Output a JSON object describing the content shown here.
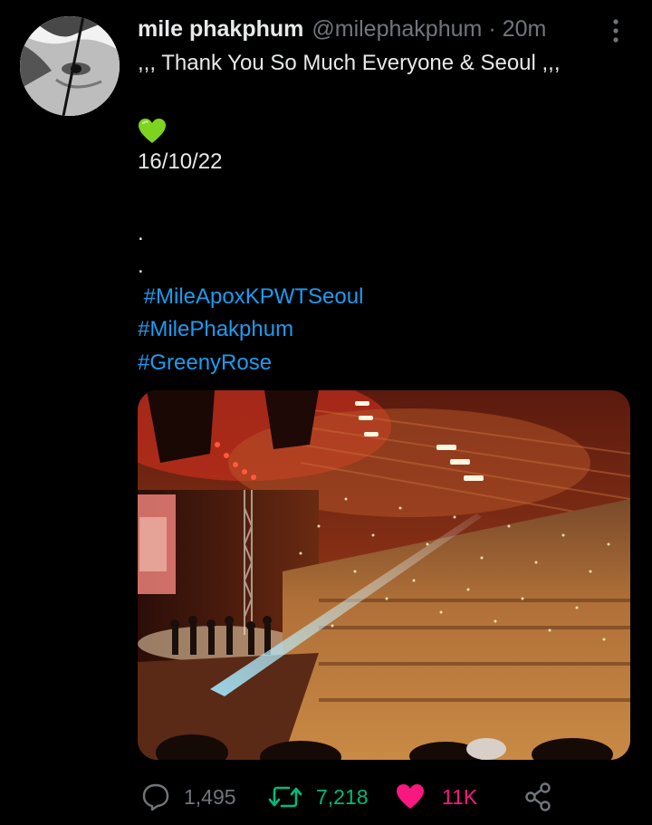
{
  "tweet": {
    "display_name": "mile phakphum",
    "handle": "@milephakphum",
    "separator": "·",
    "time": "20m",
    "line1": ",,, Thank You So Much Everyone & Seoul ,,,",
    "date_line": "16/10/22",
    "dot1": ".",
    "dot2": ".",
    "hashtags": [
      " #MileApoxKPWTSeoul",
      "#MilePhakphum",
      "#GreenyRose"
    ],
    "emoji": "green-heart"
  },
  "actions": {
    "reply_count": "1,495",
    "retweet_count": "7,218",
    "like_count": "11K"
  },
  "colors": {
    "background": "#000000",
    "text": "#e7e9ea",
    "muted": "#71767b",
    "link": "#1d9bf0",
    "retweet": "#00ba7c",
    "like": "#f91880"
  },
  "icons": [
    "more-icon",
    "reply-icon",
    "retweet-icon",
    "like-icon",
    "share-icon"
  ]
}
